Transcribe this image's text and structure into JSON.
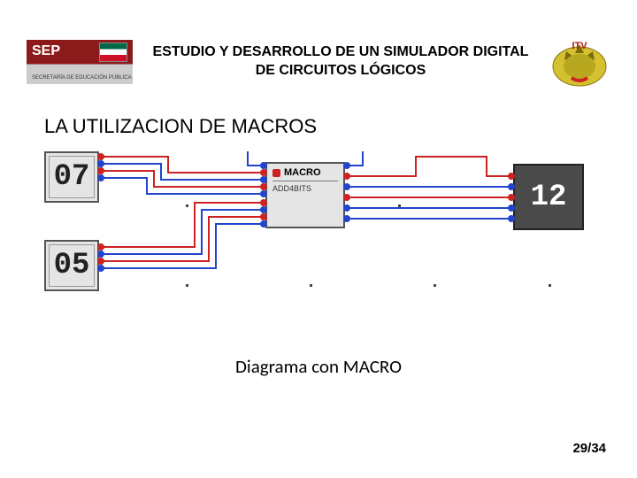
{
  "header": {
    "sep_label": "SEP",
    "sep_sub": "SECRETARÍA DE EDUCACIÓN PÚBLICA",
    "title_line1": "ESTUDIO Y DESARROLLO DE UN SIMULADOR DIGITAL",
    "title_line2": "DE CIRCUITOS LÓGICOS",
    "itv_label": "ITV"
  },
  "section_title": "LA UTILIZACION DE MACROS",
  "diagram": {
    "input_a": "07",
    "input_b": "05",
    "macro_label": "MACRO",
    "macro_sub": "ADD4BITS",
    "output": "12"
  },
  "caption": "Diagrama con MACRO",
  "page_current": "29",
  "page_total": "34"
}
